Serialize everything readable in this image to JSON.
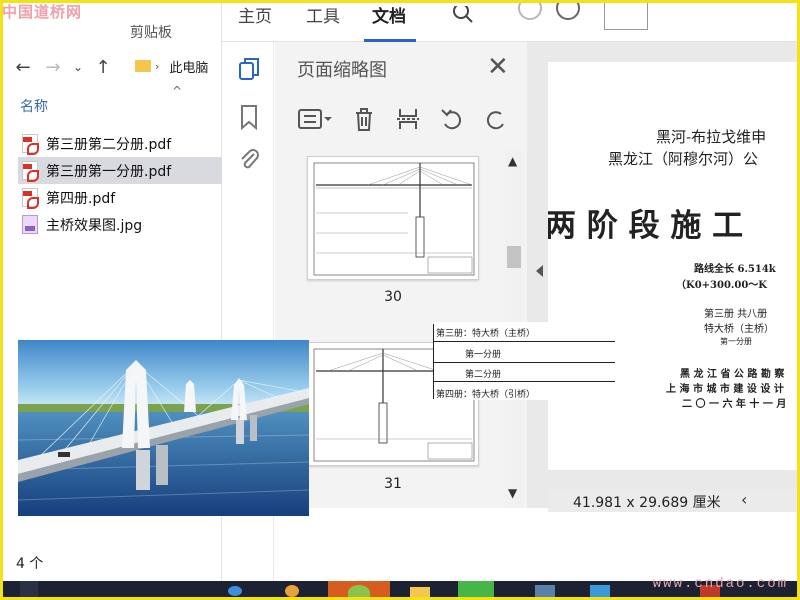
{
  "watermark": {
    "top": "中国道桥网",
    "bottom": "www.cndao.com"
  },
  "explorer": {
    "clipboard_label": "剪贴板",
    "address": "此电脑",
    "column_name": "名称",
    "files": [
      {
        "name": "第三册第二分册.pdf",
        "type": "pdf",
        "state": "normal"
      },
      {
        "name": "第三册第一分册.pdf",
        "type": "pdf",
        "state": "hover"
      },
      {
        "name": "第四册.pdf",
        "type": "pdf",
        "state": "normal"
      },
      {
        "name": "主桥效果图.jpg",
        "type": "jpg",
        "state": "normal"
      }
    ],
    "item_count": "4 个"
  },
  "pdf_app": {
    "tabs": [
      "主页",
      "工具",
      "文档"
    ],
    "active_tab": "文档",
    "thumbnail_panel": {
      "title": "页面缩略图",
      "pages": [
        "30",
        "31"
      ]
    },
    "document_page": {
      "line1": "黑河-布拉戈维申",
      "line2": "黑龙江（阿穆尔河）公",
      "big_title": "两 阶 段 施 工",
      "length": "路线全长 6.514k",
      "range": "（K0+300.00～K",
      "volume": "第三册  共八册",
      "bridge": "特大桥（主桥）",
      "sub": "第一分册",
      "org1": "黑 龙 江 省 公 路 勘 察",
      "org2": "上 海 市 城 市 建 设 设 计",
      "date": "二 〇 一 六 年 十 一 月"
    },
    "page_size": "41.981 x 29.689 厘米"
  },
  "toc_overlay": {
    "row1": "第三册：特大桥（主桥）",
    "row2": "第一分册",
    "row3": "第二分册",
    "row4": "第四册：特大桥（引桥）"
  },
  "colors": {
    "accent": "#2b63c7",
    "frame": "#f2e21a",
    "taskbar": "#1c2232"
  }
}
